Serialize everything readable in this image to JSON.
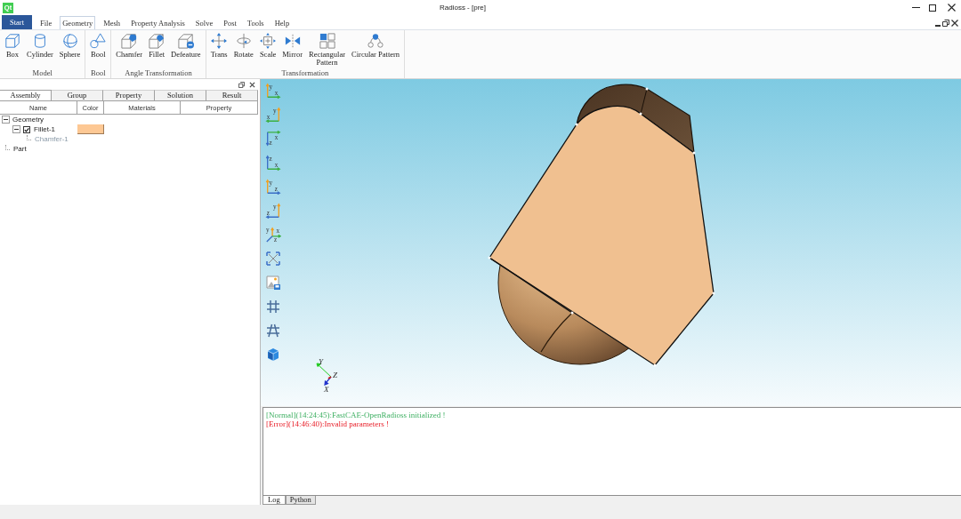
{
  "window": {
    "logo": "Qt",
    "title": "Radioss - [pre]"
  },
  "menu": {
    "app_button": "Start",
    "tabs": [
      {
        "label": "File",
        "selected": false
      },
      {
        "label": "Geometry",
        "selected": true
      },
      {
        "label": "Mesh",
        "selected": false
      },
      {
        "label": "Property Analysis",
        "selected": false
      },
      {
        "label": "Solve",
        "selected": false
      },
      {
        "label": "Post",
        "selected": false
      },
      {
        "label": "Tools",
        "selected": false
      },
      {
        "label": "Help",
        "selected": false
      }
    ]
  },
  "ribbon": {
    "groups": [
      {
        "title": "Model",
        "buttons": [
          "Box",
          "Cylinder",
          "Sphere"
        ]
      },
      {
        "title": "Bool",
        "buttons": [
          "Bool"
        ]
      },
      {
        "title": "Angle Transformation",
        "buttons": [
          "Chamfer",
          "Fillet",
          "Defeature"
        ]
      },
      {
        "title": "Transformation",
        "buttons": [
          "Trans",
          "Rotate",
          "Scale",
          "Mirror",
          "Rectangular\nPattern",
          "Circular Pattern"
        ]
      }
    ]
  },
  "panel": {
    "tabs": [
      {
        "label": "Assembly",
        "selected": true
      },
      {
        "label": "Group",
        "selected": false
      },
      {
        "label": "Property",
        "selected": false
      },
      {
        "label": "Solution",
        "selected": false
      },
      {
        "label": "Result",
        "selected": false
      }
    ],
    "columns": [
      "Name",
      "Color",
      "Materials",
      "Property"
    ],
    "tree": [
      {
        "label": "Geometry",
        "expanded": true,
        "disabled": false,
        "children": [
          {
            "label": "Fillet-1",
            "expanded": true,
            "checked": true,
            "disabled": false,
            "color": "#fdc894",
            "children": [
              {
                "label": "Chamfer-1",
                "disabled": true
              }
            ]
          }
        ]
      },
      {
        "label": "Part",
        "disabled": false
      }
    ]
  },
  "viewport": {
    "view_buttons": [
      [
        "y",
        "x"
      ],
      [
        "y",
        "x"
      ],
      [
        "x",
        "z"
      ],
      [
        "z",
        "x"
      ],
      [
        "y",
        "z"
      ],
      [
        "y",
        "z"
      ],
      [
        "y",
        "x",
        "z"
      ]
    ],
    "triad": [
      "Y",
      "Z",
      "X"
    ]
  },
  "log": {
    "lines": [
      {
        "kind": "normal",
        "text": "[Normal](14:24:45):FastCAE-OpenRadioss initialized !"
      },
      {
        "kind": "error",
        "text": "[Error](14:46:40):Invalid parameters !"
      }
    ],
    "tabs": [
      {
        "label": "Log",
        "selected": true
      },
      {
        "label": "Python",
        "selected": false
      }
    ]
  }
}
